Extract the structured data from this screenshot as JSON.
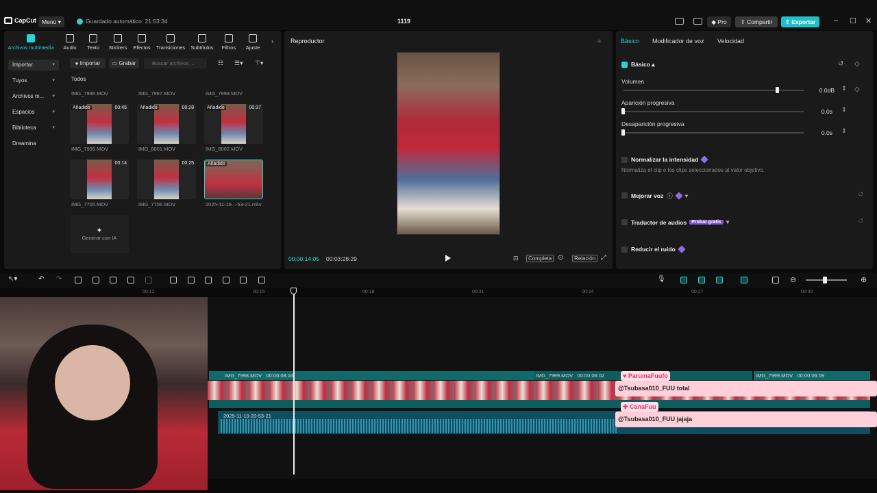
{
  "app": {
    "logo": "CapCut",
    "menu": "Menú",
    "autosave": "Guardado automático: 21:53:34",
    "project": "1119",
    "pro": "Pro",
    "share": "Compartir",
    "export": "Exportar",
    "win_min": "–",
    "win_max": "☐",
    "win_close": "✕"
  },
  "media": {
    "tabs": [
      {
        "label": "Archivos multimedia"
      },
      {
        "label": "Audio"
      },
      {
        "label": "Texto"
      },
      {
        "label": "Stickers"
      },
      {
        "label": "Efectos"
      },
      {
        "label": "Transiciones"
      },
      {
        "label": "Subtítulos"
      },
      {
        "label": "Filtros"
      },
      {
        "label": "Ajuste"
      }
    ],
    "side": [
      {
        "label": "Importar"
      },
      {
        "label": "Tuyos"
      },
      {
        "label": "Archivos m..."
      },
      {
        "label": "Espacios"
      },
      {
        "label": "Biblioteca"
      },
      {
        "label": "Dreamina"
      }
    ],
    "import_btn": "Importar",
    "record_btn": "Grabar",
    "search_placeholder": "Buscar archivos ...",
    "all": "Todos",
    "top_names": [
      "IMG_7996.MOV",
      "IMG_7997.MOV",
      "IMG_7998.MOV"
    ],
    "row1": [
      {
        "badge": "Añadido",
        "dur": "00:45",
        "name": "IMG_7999.MOV"
      },
      {
        "badge": "Añadido",
        "dur": "00:28",
        "name": "IMG_8001.MOV"
      },
      {
        "badge": "Añadido",
        "dur": "00:37",
        "name": "IMG_8002.MOV"
      }
    ],
    "row2": [
      {
        "badge": "",
        "dur": "00:14",
        "name": "IMG_7705.MOV"
      },
      {
        "badge": "",
        "dur": "00:25",
        "name": "IMG_7706.MOV"
      },
      {
        "badge": "Añadido",
        "dur": "",
        "name": "2025-11-19...-53-21.mkv"
      }
    ],
    "gen_ai": "Generar con IA"
  },
  "player": {
    "title": "Reproductor",
    "current": "00:00:14:05",
    "total": "00:03:28:29",
    "full": "Completa",
    "ratio": "Relación"
  },
  "props": {
    "tabs": [
      "Básico",
      "Modificador de voz",
      "Velocidad"
    ],
    "basic": "Básico",
    "volume": "Volumen",
    "volume_val": "0.0dB",
    "volume_level": 0.85,
    "fade_in": "Aparición progresiva",
    "fade_in_val": "0.0s",
    "fade_out": "Desaparición progresiva",
    "fade_out_val": "0.0s",
    "normalize": "Normalizar la intensidad",
    "normalize_desc": "Normaliza el clip o los clips seleccionados al valor objetivo.",
    "enhance": "Mejorar voz",
    "translator": "Traductor de audios",
    "try_free": "Probar gratis",
    "denoise": "Reducir el ruido"
  },
  "timeline": {
    "ticks": [
      "00:12",
      "00:15",
      "00:18",
      "00:21",
      "00:24",
      "00:27",
      "00:30"
    ],
    "clip1": "IMG_7998.MOV",
    "clip1_dur": "00:00:08:16",
    "clip2": "IMG_7999.MOV",
    "clip2_dur": "00:00:06:02",
    "clip3": "IMG_7999.MOV",
    "clip3_dur": "00:00:06:09",
    "audio": "2025-11-19 20-53-21"
  },
  "chat": [
    {
      "name": "ParumaFuufo",
      "msg": "@Tsubasa010_FUU total"
    },
    {
      "name": "CanaFuu",
      "msg": "@Tsubasa010_FUU jajaja"
    }
  ]
}
